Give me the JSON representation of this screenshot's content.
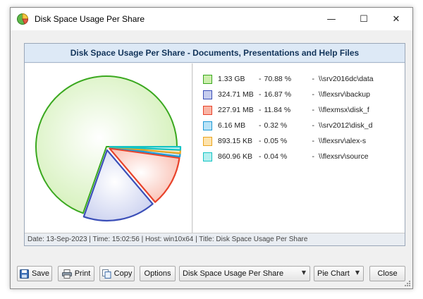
{
  "window": {
    "title": "Disk Space Usage Per Share",
    "controls": {
      "minimize": "—",
      "maximize": "☐",
      "close": "✕"
    }
  },
  "chart_data": {
    "type": "pie",
    "title": "Disk Space Usage Per Share - Documents, Presentations and Help Files",
    "slices": [
      {
        "size": "1.33 GB",
        "percent_label": "70.88 %",
        "value": 70.88,
        "share": "\\\\srv2016dc\\data",
        "fill": "#cdeeae",
        "stroke": "#3aa81f"
      },
      {
        "size": "324.71 MB",
        "percent_label": "16.87 %",
        "value": 16.87,
        "share": "\\\\flexsrv\\backup",
        "fill": "#c6cdee",
        "stroke": "#3b4fb8"
      },
      {
        "size": "227.91 MB",
        "percent_label": "11.84 %",
        "value": 11.84,
        "share": "\\\\flexmsx\\disk_f",
        "fill": "#f9b5a6",
        "stroke": "#e8422a"
      },
      {
        "size": "6.16 MB",
        "percent_label": "0.32 %",
        "value": 0.32,
        "share": "\\\\srv2012\\disk_d",
        "fill": "#b9e3f6",
        "stroke": "#1e9ad6"
      },
      {
        "size": "893.15 KB",
        "percent_label": "0.05 %",
        "value": 0.05,
        "share": "\\\\flexsrv\\alex-s",
        "fill": "#fde3ad",
        "stroke": "#eba51f"
      },
      {
        "size": "860.96 KB",
        "percent_label": "0.04 %",
        "value": 0.04,
        "share": "\\\\flexsrv\\source",
        "fill": "#b5efef",
        "stroke": "#14c4c4"
      }
    ]
  },
  "legend_separator": "-",
  "status": {
    "text": "Date: 13-Sep-2023 | Time: 15:02:56 | Host: win10x64 | Title: Disk Space Usage Per Share"
  },
  "toolbar": {
    "save_label": "Save",
    "print_label": "Print",
    "copy_label": "Copy",
    "options_label": "Options",
    "report_select_value": "Disk Space Usage Per Share",
    "chart_type_value": "Pie Chart",
    "close_label": "Close"
  }
}
